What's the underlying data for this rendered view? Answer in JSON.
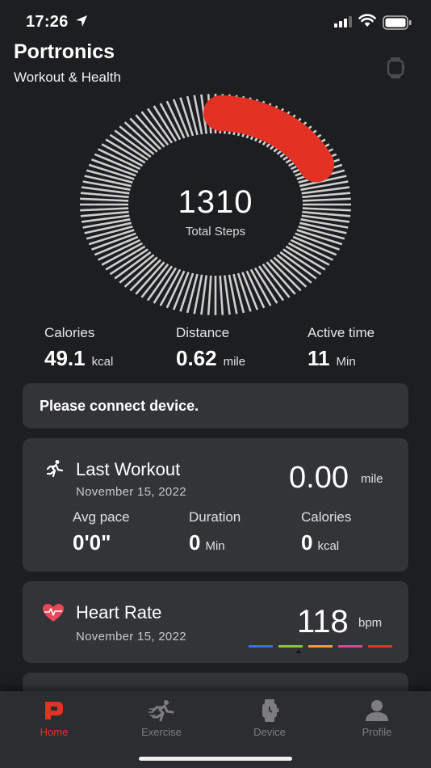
{
  "status_bar": {
    "time": "17:26"
  },
  "app": {
    "title": "Portronics",
    "subtitle": "Workout & Health"
  },
  "steps": {
    "value": "1310",
    "label": "Total Steps",
    "goal_progress_fraction": 0.17
  },
  "stats": [
    {
      "label": "Calories",
      "value": "49.1",
      "unit": "kcal"
    },
    {
      "label": "Distance",
      "value": "0.62",
      "unit": "mile"
    },
    {
      "label": "Active time",
      "value": "11",
      "unit": "Min"
    }
  ],
  "connect": {
    "message": "Please connect device."
  },
  "last_workout": {
    "title": "Last Workout",
    "date": "November 15, 2022",
    "distance": "0.00",
    "distance_unit": "mile",
    "stats": [
      {
        "label": "Avg pace",
        "value": "0'0\"",
        "unit": ""
      },
      {
        "label": "Duration",
        "value": "0",
        "unit": "Min"
      },
      {
        "label": "Calories",
        "value": "0",
        "unit": "kcal"
      }
    ]
  },
  "heart_rate": {
    "title": "Heart Rate",
    "date": "November 15, 2022",
    "value": "118",
    "unit": "bpm",
    "zone_colors": [
      "#3d6fe0",
      "#8ac444",
      "#f0a02a",
      "#e0409a",
      "#e33224"
    ],
    "active_zone_index": 1
  },
  "tabs": [
    {
      "label": "Home",
      "icon": "home-logo-icon",
      "active": true
    },
    {
      "label": "Exercise",
      "icon": "running-person-icon",
      "active": false
    },
    {
      "label": "Device",
      "icon": "smartwatch-icon",
      "active": false
    },
    {
      "label": "Profile",
      "icon": "person-icon",
      "active": false
    }
  ],
  "colors": {
    "accent": "#e33224",
    "background": "#1d1e20",
    "card": "#333437",
    "tab_inactive": "#7d7d80"
  }
}
